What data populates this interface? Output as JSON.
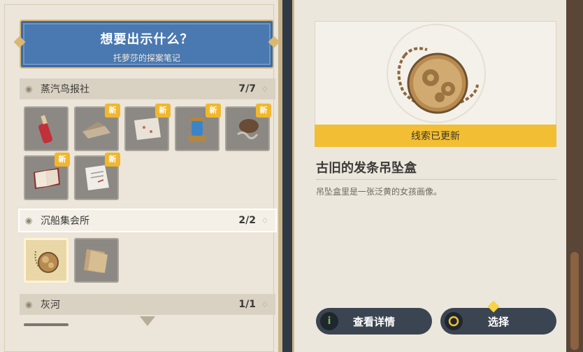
{
  "banner": {
    "title": "想要出示什么？",
    "subtitle": "托萝莎的探案笔记"
  },
  "categories": [
    {
      "name": "蒸汽鸟报社",
      "count": "7/7"
    },
    {
      "name": "沉船集会所",
      "count": "2/2"
    },
    {
      "name": "灰河",
      "count": "1/1"
    }
  ],
  "items": {
    "group1": [
      {
        "name": "red-bottle",
        "new": false
      },
      {
        "name": "envelope",
        "new": true
      },
      {
        "name": "map-paper",
        "new": true
      },
      {
        "name": "lantern",
        "new": true
      },
      {
        "name": "mechanical-part",
        "new": true
      },
      {
        "name": "notebook",
        "new": true
      },
      {
        "name": "letter",
        "new": true
      }
    ],
    "group2": [
      {
        "name": "pocket-watch-locket",
        "new": false,
        "selected": true
      },
      {
        "name": "folded-papers",
        "new": false
      }
    ]
  },
  "new_badge": "新",
  "detail": {
    "status": "线索已更新",
    "title": "古旧的发条吊坠盒",
    "description": "吊坠盒里是一张泛黄的女孩画像。"
  },
  "buttons": {
    "detail_icon": "i",
    "detail_label": "查看详情",
    "select_label": "选择"
  },
  "colors": {
    "accent": "#f2be33",
    "banner_blue": "#4a78b1",
    "button_bg": "#3b4552"
  }
}
